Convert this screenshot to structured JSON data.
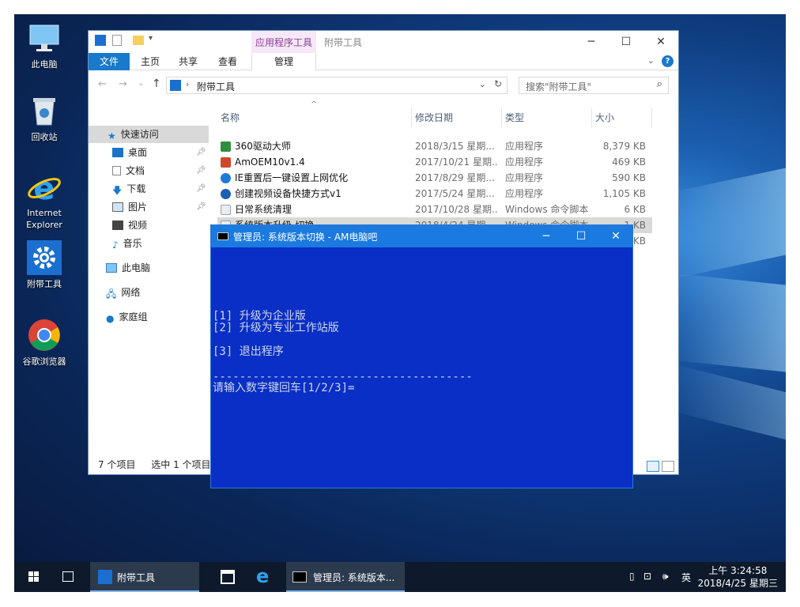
{
  "desktop": {
    "icons": [
      {
        "label": "此电脑"
      },
      {
        "label": "回收站"
      },
      {
        "label": "Internet\nExplorer"
      },
      {
        "label": "附带工具"
      },
      {
        "label": "谷歌浏览器"
      }
    ]
  },
  "explorer": {
    "context_tab_title": "应用程序工具",
    "window_title": "附带工具",
    "ribbon_tabs": {
      "file": "文件",
      "home": "主页",
      "share": "共享",
      "view": "查看",
      "manage": "管理"
    },
    "address": {
      "crumb": "附带工具"
    },
    "search": {
      "placeholder": "搜索\"附带工具\""
    },
    "nav": {
      "quick_access": "快速访问",
      "desktop": "桌面",
      "documents": "文档",
      "downloads": "下载",
      "pictures": "图片",
      "videos": "视频",
      "music": "音乐",
      "this_pc": "此电脑",
      "network": "网络",
      "homegroup": "家庭组"
    },
    "columns": {
      "name": "名称",
      "date": "修改日期",
      "type": "类型",
      "size": "大小"
    },
    "files": [
      {
        "name": "360驱动大师",
        "date": "2018/3/15 星期...",
        "type": "应用程序",
        "size": "8,379 KB",
        "color": "#2f8f3e"
      },
      {
        "name": "AmOEM10v1.4",
        "date": "2017/10/21 星期...",
        "type": "应用程序",
        "size": "469 KB",
        "color": "#d0482b"
      },
      {
        "name": "IE重置后一键设置上网优化",
        "date": "2017/8/29 星期...",
        "type": "应用程序",
        "size": "590 KB",
        "color": "#1e7ad6"
      },
      {
        "name": "创建视频设备快捷方式v1",
        "date": "2017/5/24 星期...",
        "type": "应用程序",
        "size": "1,105 KB",
        "color": "#1a5fb4"
      },
      {
        "name": "日常系统清理",
        "date": "2017/10/28 星期...",
        "type": "Windows 命令脚本",
        "size": "6 KB",
        "color": "#9aa3ad"
      },
      {
        "name": "系统版本升级-切换",
        "date": "2018/4/24 星期...",
        "type": "Windows 命令脚本",
        "size": "1 KB",
        "color": "#9aa3ad"
      }
    ],
    "hidden_row_size": "KB",
    "status": {
      "count": "7 个项目",
      "selected": "选中 1 个项目"
    }
  },
  "console": {
    "title": "管理员: 系统版本切换 - AM电脑吧",
    "lines": {
      "opt1": "[1] 升级为企业版",
      "opt2": "[2] 升级为专业工作站版",
      "opt3": "[3] 退出程序",
      "divider": "---------------------------------------",
      "prompt": "请输入数字键回车[1/2/3]="
    }
  },
  "taskbar": {
    "explorer_label": "附带工具",
    "console_label": "管理员: 系统版本...",
    "ime": "英",
    "time": "上午 3:24:58",
    "date": "2018/4/25 星期三"
  },
  "colors": {
    "accent": "#1979ca",
    "console_bg": "#0a2fc6",
    "console_title": "#1a7ae0",
    "taskbar": "#0e1a2b"
  }
}
